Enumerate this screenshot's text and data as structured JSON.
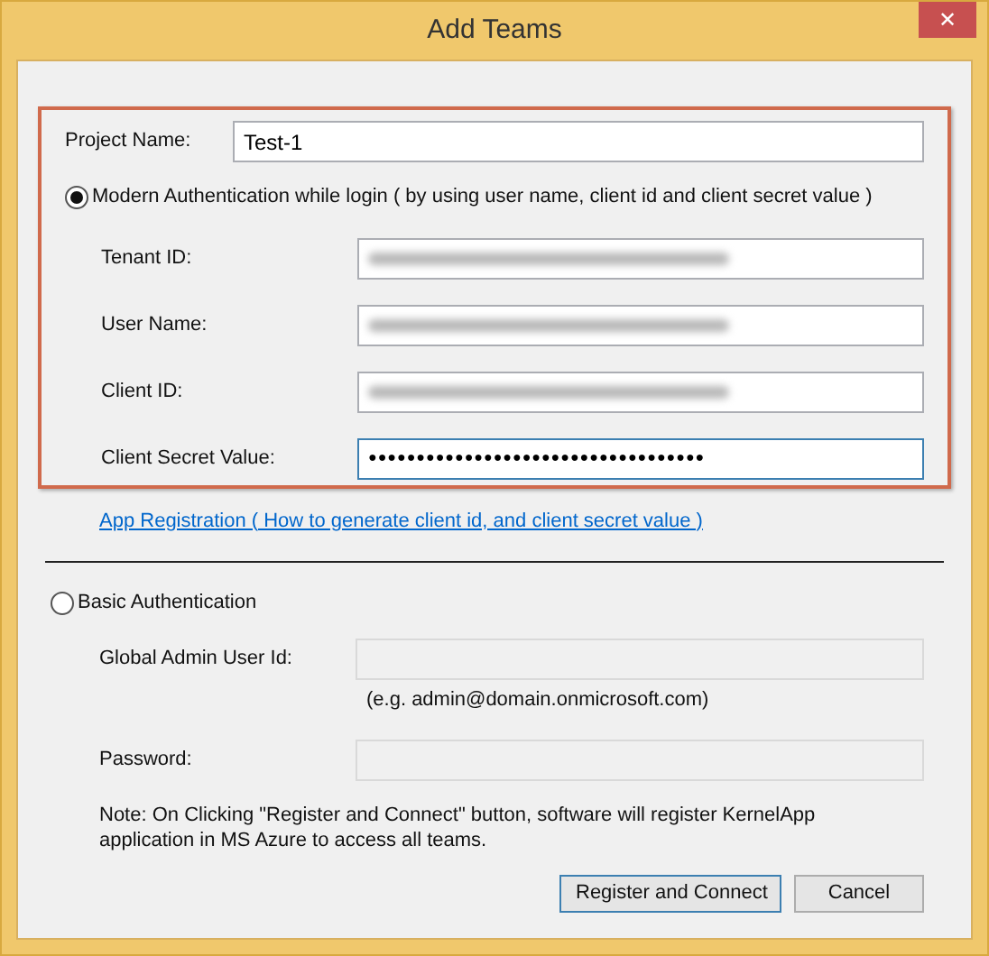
{
  "window": {
    "title": "Add Teams",
    "close": "✕"
  },
  "project": {
    "label": "Project Name:",
    "value": "Test-1"
  },
  "modern": {
    "label": "Modern Authentication while login ( by using user name, client id and client secret value )",
    "selected": true,
    "fields": [
      {
        "label": "Tenant ID:",
        "kind": "blurred"
      },
      {
        "label": "User Name:",
        "kind": "blurred"
      },
      {
        "label": "Client ID:",
        "kind": "blurred"
      },
      {
        "label": "Client Secret Value:",
        "kind": "password",
        "value": "●●●●●●●●●●●●●●●●●●●●●●●●●●●●●●●●●●●",
        "focused": true
      }
    ]
  },
  "link": "App Registration ( How to generate client id, and client secret value )",
  "basic": {
    "label": "Basic Authentication",
    "selected": false,
    "fields": [
      {
        "label": "Global Admin User Id:",
        "kind": "disabled",
        "hint": "(e.g. admin@domain.onmicrosoft.com)"
      },
      {
        "label": "Password:",
        "kind": "disabled"
      }
    ]
  },
  "note": "Note: On Clicking \"Register and Connect\" button, software will register KernelApp application in MS Azure to access all teams.",
  "buttons": [
    {
      "label": "Register and Connect",
      "default": true
    },
    {
      "label": "Cancel",
      "default": false
    }
  ]
}
